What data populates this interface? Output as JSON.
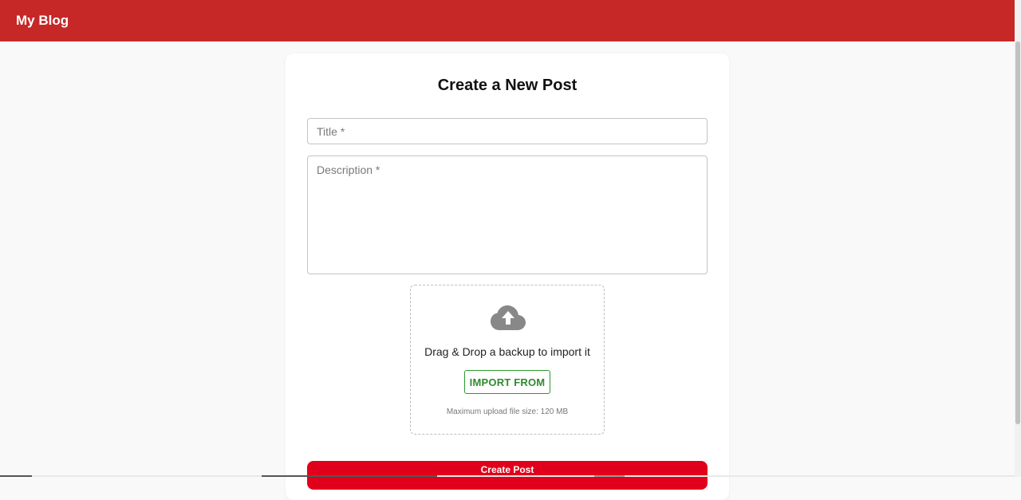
{
  "appbar": {
    "title": "My Blog",
    "color": "#c62828"
  },
  "form": {
    "heading": "Create a New Post",
    "title_placeholder": "Title *",
    "description_placeholder": "Description *",
    "title_value": "",
    "description_value": ""
  },
  "upload": {
    "icon": "cloud-upload-icon",
    "text": "Drag & Drop a backup to import it",
    "button_label": "IMPORT FROM",
    "max_size_text": "Maximum upload file size: 120 MB",
    "accent": "#2e8b2e"
  },
  "submit": {
    "label": "Create Post",
    "color": "#e0001b"
  }
}
